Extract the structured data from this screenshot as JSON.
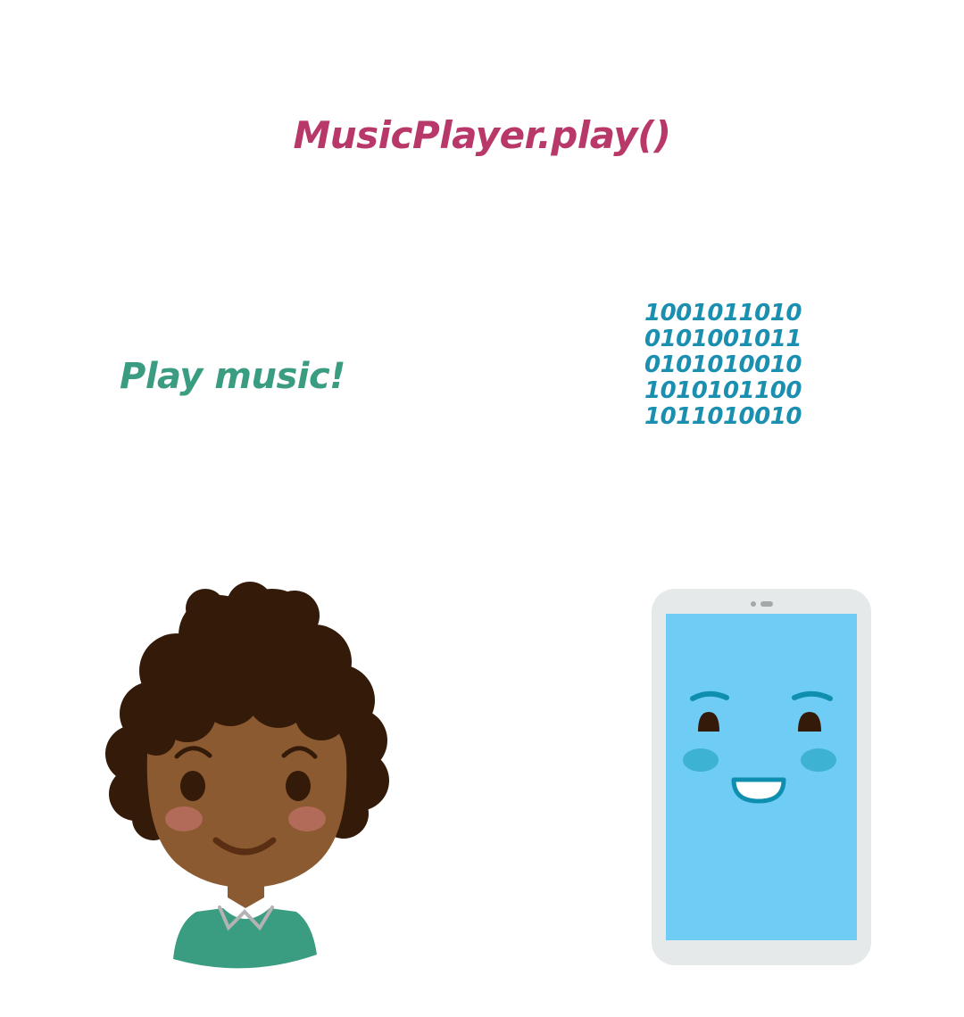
{
  "code_label": "MusicPlayer.play()",
  "speech_label": "Play music!",
  "binary_lines": [
    "1001011010",
    "0101001011",
    "0101010010",
    "1010101100",
    "1011010010"
  ],
  "colors": {
    "code": "#b9386a",
    "speech": "#3a9c80",
    "binary": "#1a8fb0",
    "hair": "#331a09",
    "skin": "#8c5a31",
    "shirt": "#3a9c80",
    "blush_person": "#b36b59",
    "phone_body": "#e5e9ea",
    "phone_screen": "#6fcdf5",
    "phone_accent": "#0f8fb0",
    "blush_phone": "#3db2d3"
  },
  "illustrations": {
    "person": "smiling-person-icon",
    "phone": "smiling-smartphone-icon"
  }
}
